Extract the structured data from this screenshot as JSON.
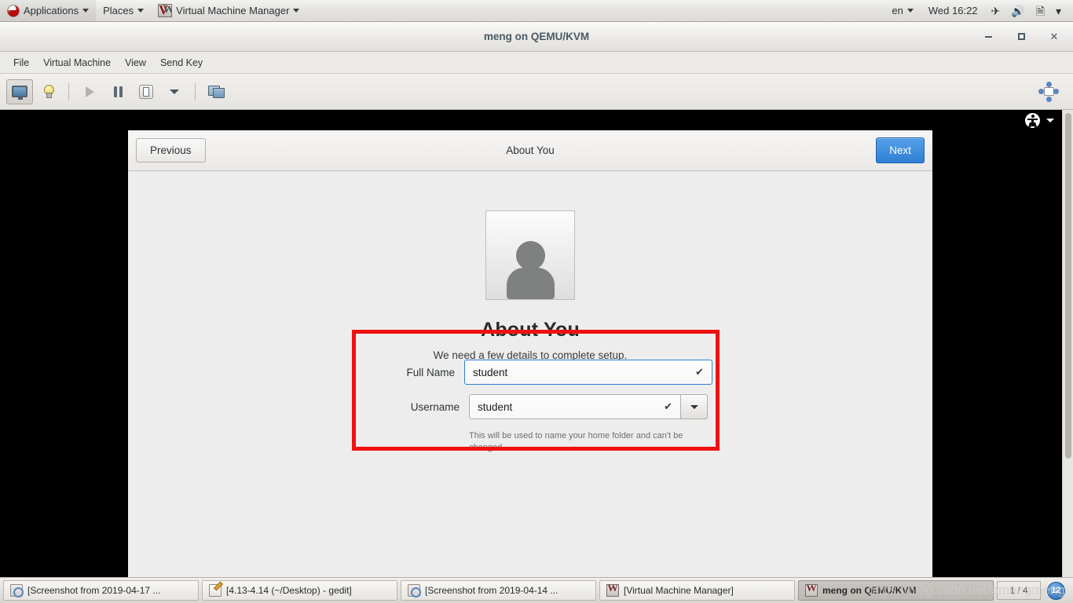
{
  "top_panel": {
    "menus": [
      {
        "label": "Applications",
        "icon": "redhat-logo-icon",
        "has_caret": true
      },
      {
        "label": "Places",
        "icon": null,
        "has_caret": true
      },
      {
        "label": "Virtual Machine Manager",
        "icon": "vmm-app-icon",
        "has_caret": true
      }
    ],
    "status": {
      "language": "en",
      "clock": "Wed 16:22",
      "tray": [
        {
          "name": "airplane-mode-icon",
          "glyph": "✈"
        },
        {
          "name": "volume-icon",
          "glyph": "🔊"
        },
        {
          "name": "battery-icon",
          "glyph": "🗎"
        },
        {
          "name": "chevron-down-icon",
          "glyph": "▾"
        }
      ]
    }
  },
  "vmm_window": {
    "title": "meng on QEMU/KVM",
    "window_controls": {
      "minimize": "–",
      "maximize": "□",
      "close": "✕"
    },
    "menubar": [
      "File",
      "Virtual Machine",
      "View",
      "Send Key"
    ],
    "toolbar": [
      {
        "name": "show-console-button",
        "icon": "monitor-icon",
        "active": true
      },
      {
        "name": "show-details-button",
        "icon": "lightbulb-icon",
        "active": false
      },
      {
        "name": "run-button",
        "icon": "play-icon",
        "active": false,
        "disabled": true
      },
      {
        "name": "pause-button",
        "icon": "pause-icon",
        "active": false
      },
      {
        "name": "shutdown-button",
        "icon": "shutdown-icon",
        "active": false
      },
      {
        "name": "shutdown-options-button",
        "icon": "chevron-down-icon",
        "active": false
      },
      {
        "name": "snapshots-button",
        "icon": "snapshots-icon",
        "active": false
      }
    ],
    "toolbar_right": {
      "name": "resize-to-vm-button",
      "icon": "resize-arrows-icon"
    }
  },
  "guest": {
    "accessibility": {
      "icon": "accessibility-icon",
      "caret": "chevron-down-icon"
    },
    "installer": {
      "previous_label": "Previous",
      "title": "About You",
      "next_label": "Next",
      "avatar_icon": "user-avatar-icon",
      "heading": "About You",
      "subtitle": "We need a few details to complete setup.",
      "fields": [
        {
          "label": "Full Name",
          "value": "student",
          "valid_icon": "check-icon",
          "focused": true,
          "has_dropdown": false
        },
        {
          "label": "Username",
          "value": "student",
          "valid_icon": "check-icon",
          "focused": false,
          "has_dropdown": true
        }
      ],
      "helper_text": "This will be used to name your home folder and can't be changed."
    },
    "highlight_color": "#ee1111"
  },
  "taskbar": {
    "tasks": [
      {
        "label": "[Screenshot from 2019-04-17 ...",
        "icon": "screenshot-icon",
        "active": false
      },
      {
        "label": "[4.13-4.14 (~/Desktop) - gedit]",
        "icon": "gedit-icon",
        "active": false
      },
      {
        "label": "[Screenshot from 2019-04-14 ...",
        "icon": "screenshot-icon",
        "active": false
      },
      {
        "label": "[Virtual Machine Manager]",
        "icon": "vmm-icon",
        "active": false
      },
      {
        "label": "meng on QEMU/KVM",
        "icon": "vmm-icon",
        "active": true
      }
    ],
    "workspace": {
      "label": "1 / 4",
      "badge": "12"
    }
  },
  "watermark": "https://blog.csdn.net/bmengmeng",
  "colors": {
    "accent_blue": "#2f7fd4",
    "highlight_red": "#ee1111",
    "panel_bg": "#e4e2df",
    "installer_bg": "#ededed"
  }
}
